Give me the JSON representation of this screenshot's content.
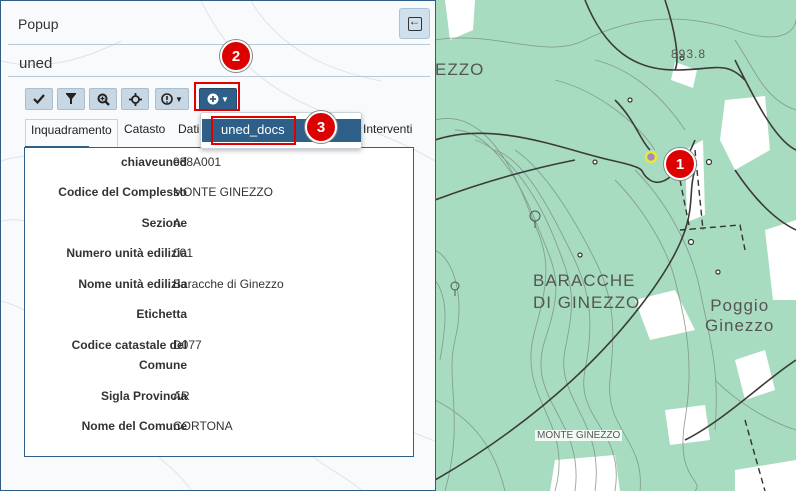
{
  "panel": {
    "title": "Popup",
    "layer_name": "uned",
    "toolbar_icons": [
      "check-icon",
      "filter-icon",
      "zoom-icon",
      "move-icon",
      "info-dropdown",
      "plus-dropdown"
    ]
  },
  "tabs": [
    {
      "label": "Inquadramento",
      "active": true
    },
    {
      "label": "Catasto",
      "active": false
    },
    {
      "label": "Dati",
      "active": false
    },
    {
      "label": "Interventi",
      "active": false
    }
  ],
  "fields": [
    {
      "label": "chiaveuned",
      "value": "038A001"
    },
    {
      "label": "Codice del Complesso",
      "value": "MONTE GINEZZO"
    },
    {
      "label": "Sezione",
      "value": "A"
    },
    {
      "label": "Numero unità edilizia",
      "value": "001"
    },
    {
      "label": "Nome unità edilizia",
      "value": "Baracche di Ginezzo"
    },
    {
      "label": "Etichetta",
      "value": ""
    },
    {
      "label": "Codice catastale del Comune",
      "value": "D077"
    },
    {
      "label": "Sigla Provincia",
      "value": "AR"
    },
    {
      "label": "Nome del Comune",
      "value": "CORTONA"
    }
  ],
  "dropdown": {
    "item": "uned_docs"
  },
  "map": {
    "labels": {
      "ezzo": "EZZO",
      "baracche_1": "BARACCHE",
      "baracche_2": "DI GINEZZO",
      "poggio_1": "Poggio",
      "poggio_2": "Ginezzo",
      "elevation": "893.8",
      "monte": "MONTE GINEZZO"
    }
  },
  "annotations": {
    "b1": "1",
    "b2": "2",
    "b3": "3"
  },
  "colors": {
    "accent": "#2e5f88",
    "map_green": "#a8dcc0",
    "highlight": "#e00000"
  }
}
